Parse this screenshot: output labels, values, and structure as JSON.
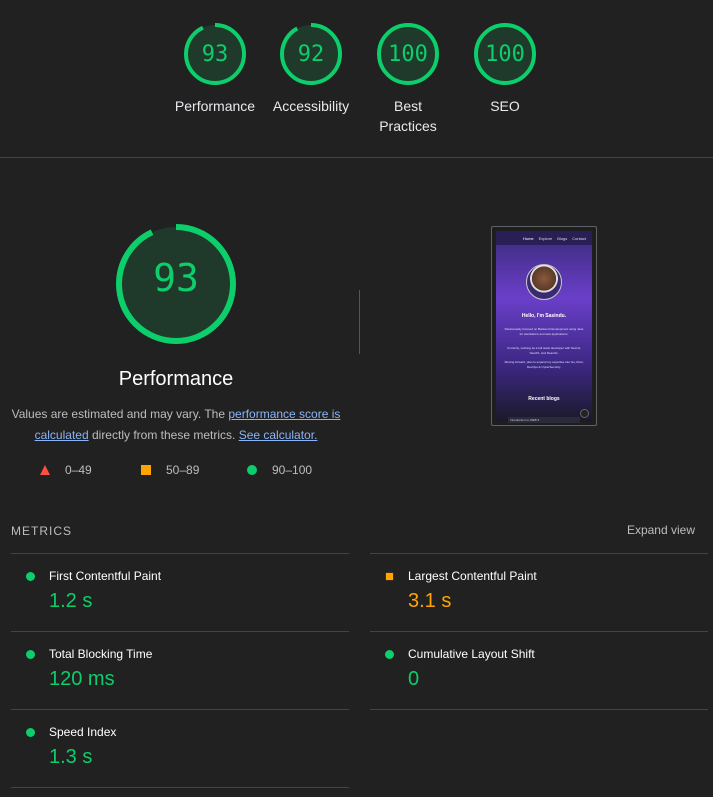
{
  "categories": [
    {
      "score": "93",
      "label": "Performance",
      "fraction": 0.93
    },
    {
      "score": "92",
      "label": "Accessibility",
      "fraction": 0.92
    },
    {
      "score": "100",
      "label": "Best Practices",
      "fraction": 1.0
    },
    {
      "score": "100",
      "label": "SEO",
      "fraction": 1.0
    }
  ],
  "main": {
    "score": "93",
    "fraction": 0.93,
    "title": "Performance",
    "note_prefix": "Values are estimated and may vary. The ",
    "note_link1": "performance score is calculated",
    "note_middle": " directly from these metrics. ",
    "note_link2": "See calculator."
  },
  "legend": [
    {
      "range": "0–49",
      "shape": "triangle",
      "color": "#ff4e42"
    },
    {
      "range": "50–89",
      "shape": "square",
      "color": "#ffa400"
    },
    {
      "range": "90–100",
      "shape": "circle",
      "color": "#0cce6b"
    }
  ],
  "preview": {
    "nav": [
      "Home",
      "Explore",
      "Blogs",
      "Contact"
    ],
    "hello": "Hello, I'm Sasindu.",
    "para1": "Passionately focused on Backend Development using Java for standalone and web applications.",
    "para2": "Currently, working as a full stack developer with NextJs, NestJS, and ReactJs.",
    "para3": "Moving forward, plan to expand my expertise into Go, Rust, DevOps & CyberSecurity.",
    "recent": "Recent blogs",
    "blog_item": "Introduction to WEB 3"
  },
  "metrics": {
    "title": "METRICS",
    "expand": "Expand view",
    "items": [
      {
        "name": "First Contentful Paint",
        "value": "1.2 s",
        "status": "green"
      },
      {
        "name": "Largest Contentful Paint",
        "value": "3.1 s",
        "status": "orange"
      },
      {
        "name": "Total Blocking Time",
        "value": "120 ms",
        "status": "green"
      },
      {
        "name": "Cumulative Layout Shift",
        "value": "0",
        "status": "green"
      },
      {
        "name": "Speed Index",
        "value": "1.3 s",
        "status": "green"
      }
    ]
  },
  "colors": {
    "pass": "#0cce6b",
    "average": "#ffa400",
    "fail": "#ff4e42"
  }
}
